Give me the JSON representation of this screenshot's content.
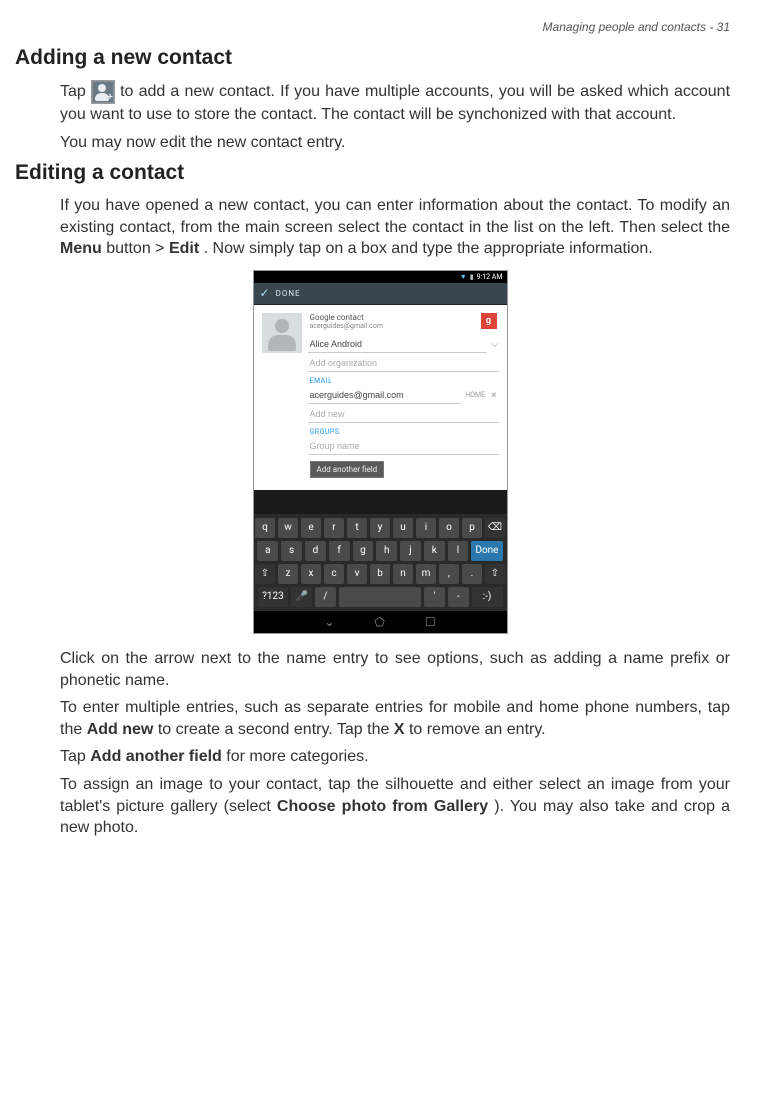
{
  "page": {
    "header": "Managing people and contacts - 31"
  },
  "sections": {
    "add": {
      "title": "Adding a new contact",
      "p1_a": "Tap ",
      "p1_b": " to add a new contact. If you have multiple accounts, you will be asked which account you want to use to store the contact. The contact will be synchonized with that account.",
      "p2": "You may now edit the new contact entry."
    },
    "edit": {
      "title": "Editing a contact",
      "intro_a": "If you have opened a new contact, you can enter information about the contact. To modify an existing contact, from the main screen select the contact in the  list on the left. Then select the ",
      "intro_b1": "Menu",
      "intro_c": " button > ",
      "intro_b2": "Edit",
      "intro_d": ". Now simply tap on a box and type the appropriate information.",
      "after1": "Click on the arrow next to the name entry to see options, such as adding a name prefix or phonetic name.",
      "after2_a": "To enter multiple entries, such as separate entries for mobile and home phone numbers, tap the ",
      "after2_b1": "Add new",
      "after2_c": " to create a second entry. Tap the ",
      "after2_b2": "X",
      "after2_d": " to remove an entry.",
      "after3_a": "Tap ",
      "after3_b": "Add another field",
      "after3_c": " for more categories.",
      "after4_a": "To assign an image to your contact, tap the silhouette and either select an image from your tablet's picture gallery (select ",
      "after4_b": "Choose photo from Gallery",
      "after4_c": "). You may also take and crop a new photo."
    }
  },
  "screenshot": {
    "status": {
      "time": "9:12 AM"
    },
    "actionbar": {
      "done": "DONE"
    },
    "account": {
      "type": "Google contact",
      "email": "acerguides@gmail.com",
      "badge": "g"
    },
    "fields": {
      "name_value": "Alice Android",
      "org_placeholder": "Add organization",
      "email_label": "EMAIL",
      "email_value": "acerguides@gmail.com",
      "email_type": "HOME",
      "addnew_placeholder": "Add new",
      "groups_label": "GROUPS",
      "group_placeholder": "Group name",
      "add_another": "Add another field"
    },
    "keyboard": {
      "r1": [
        "q",
        "w",
        "e",
        "r",
        "t",
        "y",
        "u",
        "i",
        "o",
        "p",
        "⌫"
      ],
      "r2": [
        "a",
        "s",
        "d",
        "f",
        "g",
        "h",
        "j",
        "k",
        "l",
        "Done"
      ],
      "r3": [
        "⇧",
        "z",
        "x",
        "c",
        "v",
        "b",
        "n",
        "m",
        ",",
        ".",
        "⇧"
      ],
      "r4": [
        "?123",
        "🎤",
        "/",
        " ",
        "'",
        "-",
        ":-)"
      ]
    }
  }
}
